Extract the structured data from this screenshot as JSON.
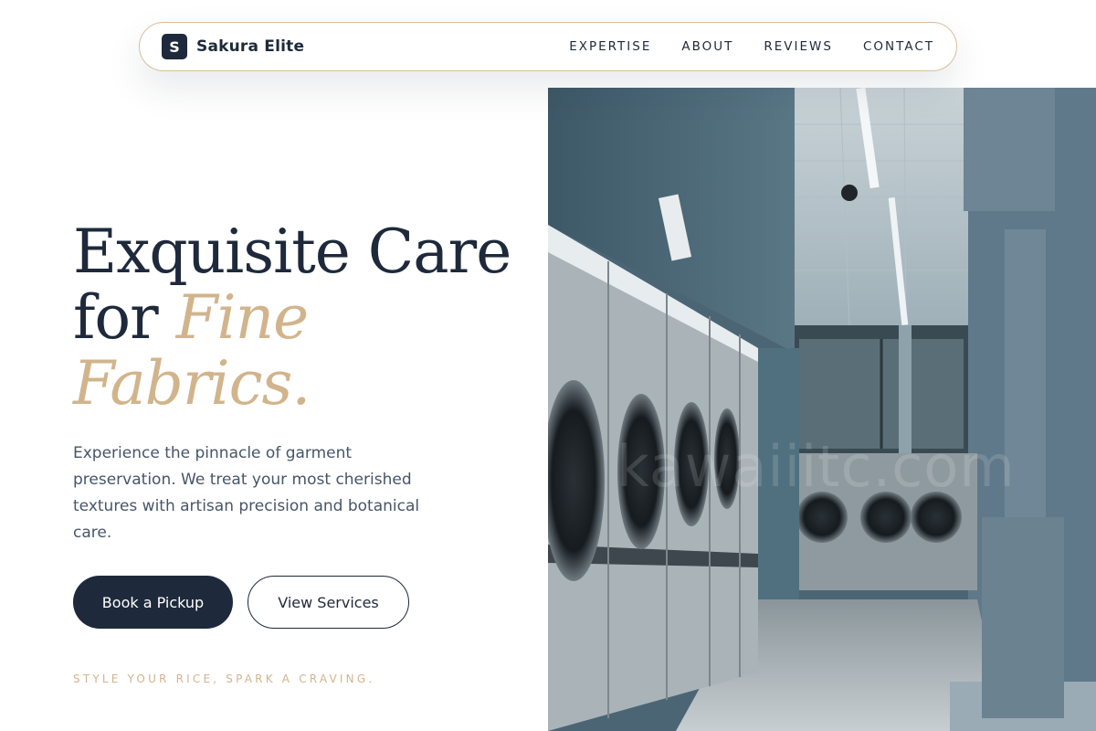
{
  "brand": {
    "logo_letter": "S",
    "name": "Sakura Elite"
  },
  "nav": {
    "links": [
      {
        "label": "EXPERTISE"
      },
      {
        "label": "ABOUT"
      },
      {
        "label": "REVIEWS"
      },
      {
        "label": "CONTACT"
      }
    ]
  },
  "hero": {
    "headline_line1": "Exquisite Care",
    "headline_for": "for",
    "headline_accent1": "Fine",
    "headline_accent2": "Fabrics.",
    "description": "Experience the pinnacle of garment preservation. We treat your most cherished textures with artisan precision and botanical care.",
    "primary_button": "Book a Pickup",
    "secondary_button": "View Services",
    "tagline": "STYLE YOUR RICE, SPARK A CRAVING.",
    "image": {
      "subject": "laundromat-interior-photo",
      "watermark": "kawaiiitc.com"
    }
  },
  "colors": {
    "navy": "#1e293b",
    "tan_accent": "#d2b48c",
    "body_text": "#475569",
    "nav_border": "#d9bf9c"
  }
}
